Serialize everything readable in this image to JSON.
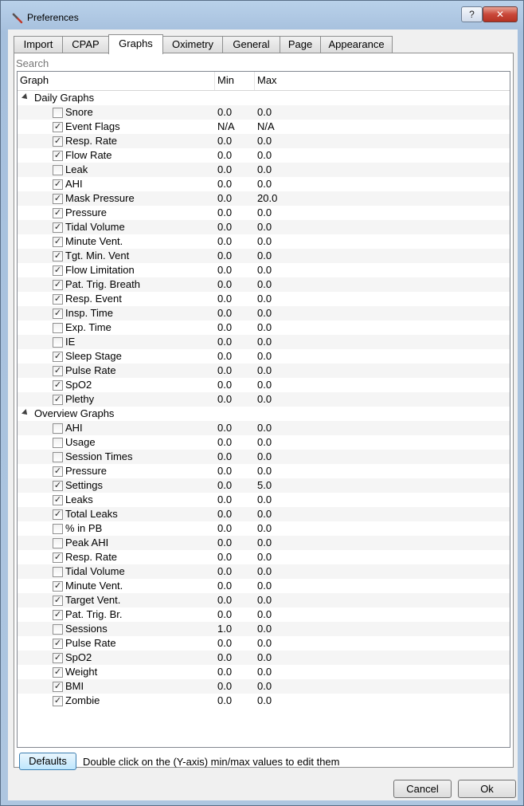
{
  "window": {
    "title": "Preferences",
    "help_label": "?",
    "close_label": "✕"
  },
  "tabs": [
    "Import",
    "CPAP",
    "Graphs",
    "Oximetry",
    "General",
    "Page",
    "Appearance"
  ],
  "active_tab": "Graphs",
  "search": {
    "placeholder": "Search"
  },
  "columns": {
    "graph": "Graph",
    "min": "Min",
    "max": "Max"
  },
  "groups": [
    {
      "label": "Daily Graphs",
      "expanded": true,
      "items": [
        {
          "name": "Snore",
          "checked": false,
          "min": "0.0",
          "max": "0.0"
        },
        {
          "name": "Event Flags",
          "checked": true,
          "min": "N/A",
          "max": "N/A"
        },
        {
          "name": "Resp. Rate",
          "checked": true,
          "min": "0.0",
          "max": "0.0"
        },
        {
          "name": "Flow Rate",
          "checked": true,
          "min": "0.0",
          "max": "0.0"
        },
        {
          "name": "Leak",
          "checked": false,
          "min": "0.0",
          "max": "0.0"
        },
        {
          "name": "AHI",
          "checked": true,
          "min": "0.0",
          "max": "0.0"
        },
        {
          "name": "Mask Pressure",
          "checked": true,
          "min": "0.0",
          "max": "20.0"
        },
        {
          "name": "Pressure",
          "checked": true,
          "min": "0.0",
          "max": "0.0"
        },
        {
          "name": "Tidal Volume",
          "checked": true,
          "min": "0.0",
          "max": "0.0"
        },
        {
          "name": "Minute Vent.",
          "checked": true,
          "min": "0.0",
          "max": "0.0"
        },
        {
          "name": "Tgt. Min. Vent",
          "checked": true,
          "min": "0.0",
          "max": "0.0"
        },
        {
          "name": "Flow Limitation",
          "checked": true,
          "min": "0.0",
          "max": "0.0"
        },
        {
          "name": "Pat. Trig. Breath",
          "checked": true,
          "min": "0.0",
          "max": "0.0"
        },
        {
          "name": "Resp. Event",
          "checked": true,
          "min": "0.0",
          "max": "0.0"
        },
        {
          "name": "Insp. Time",
          "checked": true,
          "min": "0.0",
          "max": "0.0"
        },
        {
          "name": "Exp. Time",
          "checked": false,
          "min": "0.0",
          "max": "0.0"
        },
        {
          "name": "IE",
          "checked": false,
          "min": "0.0",
          "max": "0.0"
        },
        {
          "name": "Sleep Stage",
          "checked": true,
          "min": "0.0",
          "max": "0.0"
        },
        {
          "name": "Pulse Rate",
          "checked": true,
          "min": "0.0",
          "max": "0.0"
        },
        {
          "name": "SpO2",
          "checked": true,
          "min": "0.0",
          "max": "0.0"
        },
        {
          "name": "Plethy",
          "checked": true,
          "min": "0.0",
          "max": "0.0"
        }
      ]
    },
    {
      "label": "Overview Graphs",
      "expanded": true,
      "items": [
        {
          "name": "AHI",
          "checked": false,
          "min": "0.0",
          "max": "0.0"
        },
        {
          "name": "Usage",
          "checked": false,
          "min": "0.0",
          "max": "0.0"
        },
        {
          "name": "Session Times",
          "checked": false,
          "min": "0.0",
          "max": "0.0"
        },
        {
          "name": "Pressure",
          "checked": true,
          "min": "0.0",
          "max": "0.0"
        },
        {
          "name": "Settings",
          "checked": true,
          "min": "0.0",
          "max": "5.0"
        },
        {
          "name": "Leaks",
          "checked": true,
          "min": "0.0",
          "max": "0.0"
        },
        {
          "name": "Total Leaks",
          "checked": true,
          "min": "0.0",
          "max": "0.0"
        },
        {
          "name": "% in PB",
          "checked": false,
          "min": "0.0",
          "max": "0.0"
        },
        {
          "name": "Peak AHI",
          "checked": false,
          "min": "0.0",
          "max": "0.0"
        },
        {
          "name": "Resp. Rate",
          "checked": true,
          "min": "0.0",
          "max": "0.0"
        },
        {
          "name": "Tidal Volume",
          "checked": false,
          "min": "0.0",
          "max": "0.0"
        },
        {
          "name": "Minute Vent.",
          "checked": true,
          "min": "0.0",
          "max": "0.0"
        },
        {
          "name": "Target Vent.",
          "checked": true,
          "min": "0.0",
          "max": "0.0"
        },
        {
          "name": "Pat. Trig. Br.",
          "checked": true,
          "min": "0.0",
          "max": "0.0"
        },
        {
          "name": "Sessions",
          "checked": false,
          "min": "1.0",
          "max": "0.0"
        },
        {
          "name": "Pulse Rate",
          "checked": true,
          "min": "0.0",
          "max": "0.0"
        },
        {
          "name": "SpO2",
          "checked": true,
          "min": "0.0",
          "max": "0.0"
        },
        {
          "name": "Weight",
          "checked": true,
          "min": "0.0",
          "max": "0.0"
        },
        {
          "name": "BMI",
          "checked": true,
          "min": "0.0",
          "max": "0.0"
        },
        {
          "name": "Zombie",
          "checked": true,
          "min": "0.0",
          "max": "0.0"
        }
      ]
    }
  ],
  "footer": {
    "defaults_label": "Defaults",
    "hint": "Double click on the (Y-axis) min/max values to edit them",
    "cancel_label": "Cancel",
    "ok_label": "Ok"
  }
}
